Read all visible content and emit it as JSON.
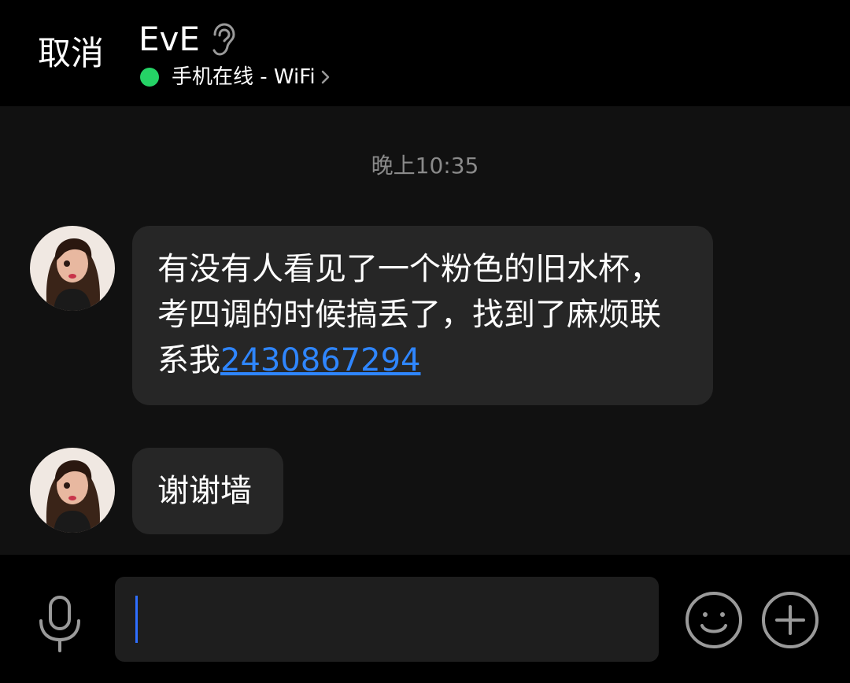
{
  "header": {
    "cancel_label": "取消",
    "contact_name": "EvE",
    "ear_icon": "ear-icon",
    "status_text": "手机在线 - WiFi",
    "online_color": "#25d366"
  },
  "chat": {
    "timestamp": "晚上10:35",
    "messages": [
      {
        "sender_avatar": "avatar",
        "text": "有没有人看见了一个粉色的旧水杯，考四调的时候搞丢了，找到了麻烦联系我",
        "link": "2430867294"
      },
      {
        "sender_avatar": "avatar",
        "text": "谢谢墙"
      }
    ]
  },
  "input_bar": {
    "mic_icon": "microphone-icon",
    "input_value": "",
    "emoji_icon": "smiley-icon",
    "plus_icon": "plus-icon",
    "caret_color": "#2f6fff",
    "link_color": "#2f86ff"
  }
}
